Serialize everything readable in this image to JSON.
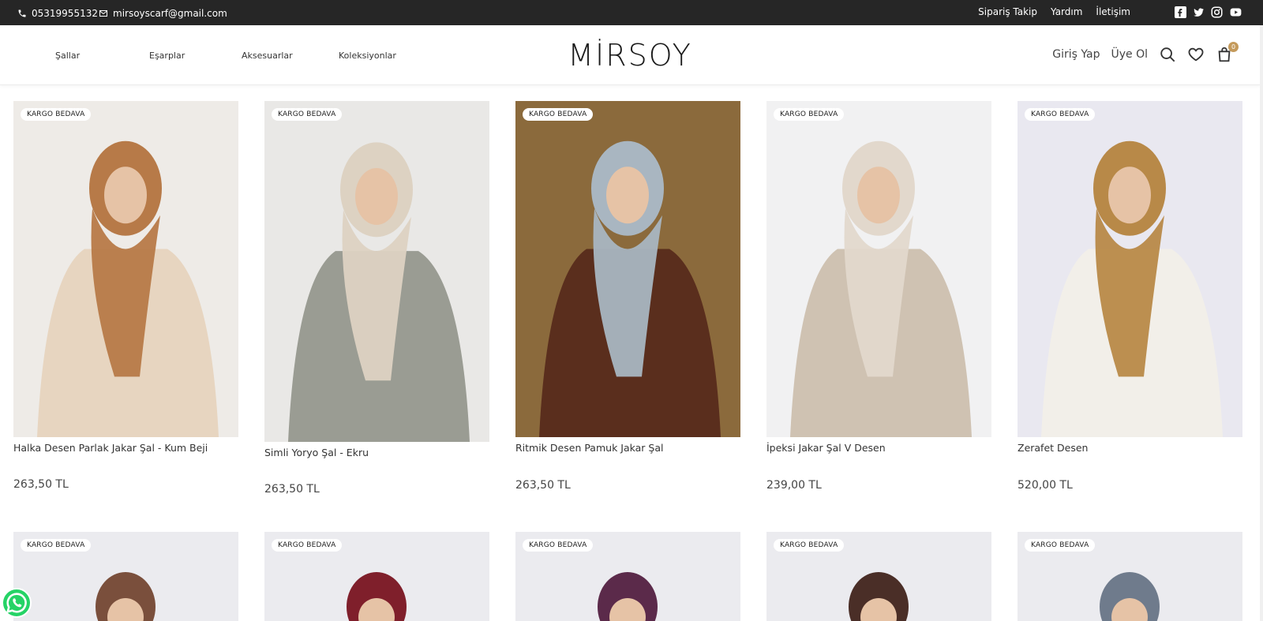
{
  "topbar": {
    "phone": "05319955132",
    "email": "mirsoyscarf@gmail.com",
    "links": [
      "Sipariş Takip",
      "Yardım",
      "İletişim"
    ],
    "socials": [
      "facebook-icon",
      "twitter-icon",
      "instagram-icon",
      "youtube-icon"
    ]
  },
  "header": {
    "nav": [
      "Şallar",
      "Eşarplar",
      "Aksesuarlar",
      "Koleksiyonlar"
    ],
    "logo": "MİRSOY",
    "login": "Giriş Yap",
    "register": "Üye Ol",
    "cart_count": "0"
  },
  "products": [
    {
      "badge": "KARGO BEDAVA",
      "name": "Halka Desen Parlak Jakar Şal - Kum Beji",
      "price": "263,50 TL",
      "scarf_color": "#b77a48",
      "bg": "#eeebe7",
      "outfit": "#e7d5c0"
    },
    {
      "badge": "KARGO BEDAVA",
      "name": "Simli Yoryo Şal - Ekru",
      "price": "263,50 TL",
      "scarf_color": "#ddd2c2",
      "bg": "#e9e8e6",
      "outfit": "#9a9c93"
    },
    {
      "badge": "KARGO BEDAVA",
      "name": "Ritmik Desen Pamuk Jakar Şal",
      "price": "263,50 TL",
      "scarf_color": "#a9b6c1",
      "bg": "#8b6a3c",
      "outfit": "#5a2e1d"
    },
    {
      "badge": "KARGO BEDAVA",
      "name": "İpeksi Jakar Şal V Desen",
      "price": "239,00 TL",
      "scarf_color": "#e2d8cc",
      "bg": "#f1f1f2",
      "outfit": "#cfc2b2"
    },
    {
      "badge": "KARGO BEDAVA",
      "name": "Zerafet Desen",
      "price": "520,00 TL",
      "scarf_color": "#b88948",
      "bg": "#e9e8f0",
      "outfit": "#f2efe9"
    }
  ],
  "products_row2": [
    {
      "badge": "KARGO BEDAVA",
      "scarf_color": "#7a4f3c"
    },
    {
      "badge": "KARGO BEDAVA",
      "scarf_color": "#7f1f2b"
    },
    {
      "badge": "KARGO BEDAVA",
      "scarf_color": "#5b2a4a"
    },
    {
      "badge": "KARGO BEDAVA",
      "scarf_color": "#4a2e27"
    },
    {
      "badge": "KARGO BEDAVA",
      "scarf_color": "#6f7b8c"
    }
  ]
}
